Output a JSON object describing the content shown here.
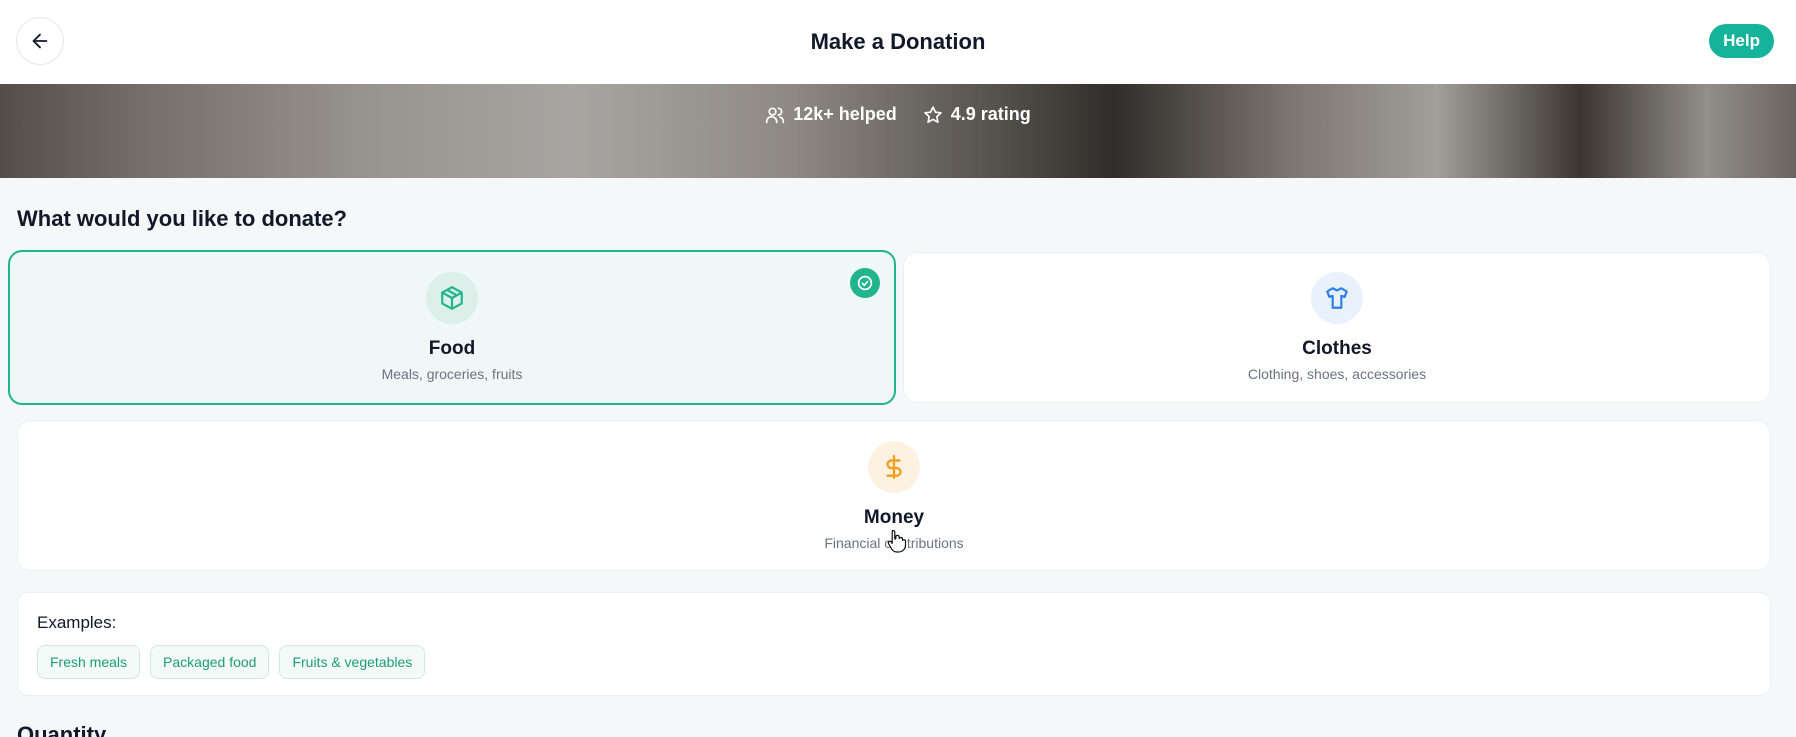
{
  "header": {
    "title": "Make a Donation",
    "help_label": "Help",
    "back_icon": "arrow-left-icon"
  },
  "hero": {
    "stats": [
      {
        "icon": "users-icon",
        "label": "12k+ helped"
      },
      {
        "icon": "star-icon",
        "label": "4.9 rating"
      }
    ]
  },
  "donate": {
    "heading": "What would you like to donate?",
    "options": [
      {
        "title": "Food",
        "subtitle": "Meals, groceries, fruits",
        "icon": "package-icon",
        "selected": true,
        "color": "#21b58e"
      },
      {
        "title": "Clothes",
        "subtitle": "Clothing, shoes, accessories",
        "icon": "shirt-icon",
        "selected": false,
        "color": "#2b7de9"
      },
      {
        "title": "Money",
        "subtitle": "Financial contributions",
        "icon": "dollar-icon",
        "selected": false,
        "color": "#f0a020"
      }
    ]
  },
  "examples": {
    "label": "Examples:",
    "chips": [
      "Fresh meals",
      "Packaged food",
      "Fruits & vegetables"
    ]
  },
  "quantity": {
    "heading": "Quantity"
  },
  "colors": {
    "accent": "#15b39a",
    "selected_border": "#21b58e",
    "selected_bg": "#eff8f7"
  }
}
